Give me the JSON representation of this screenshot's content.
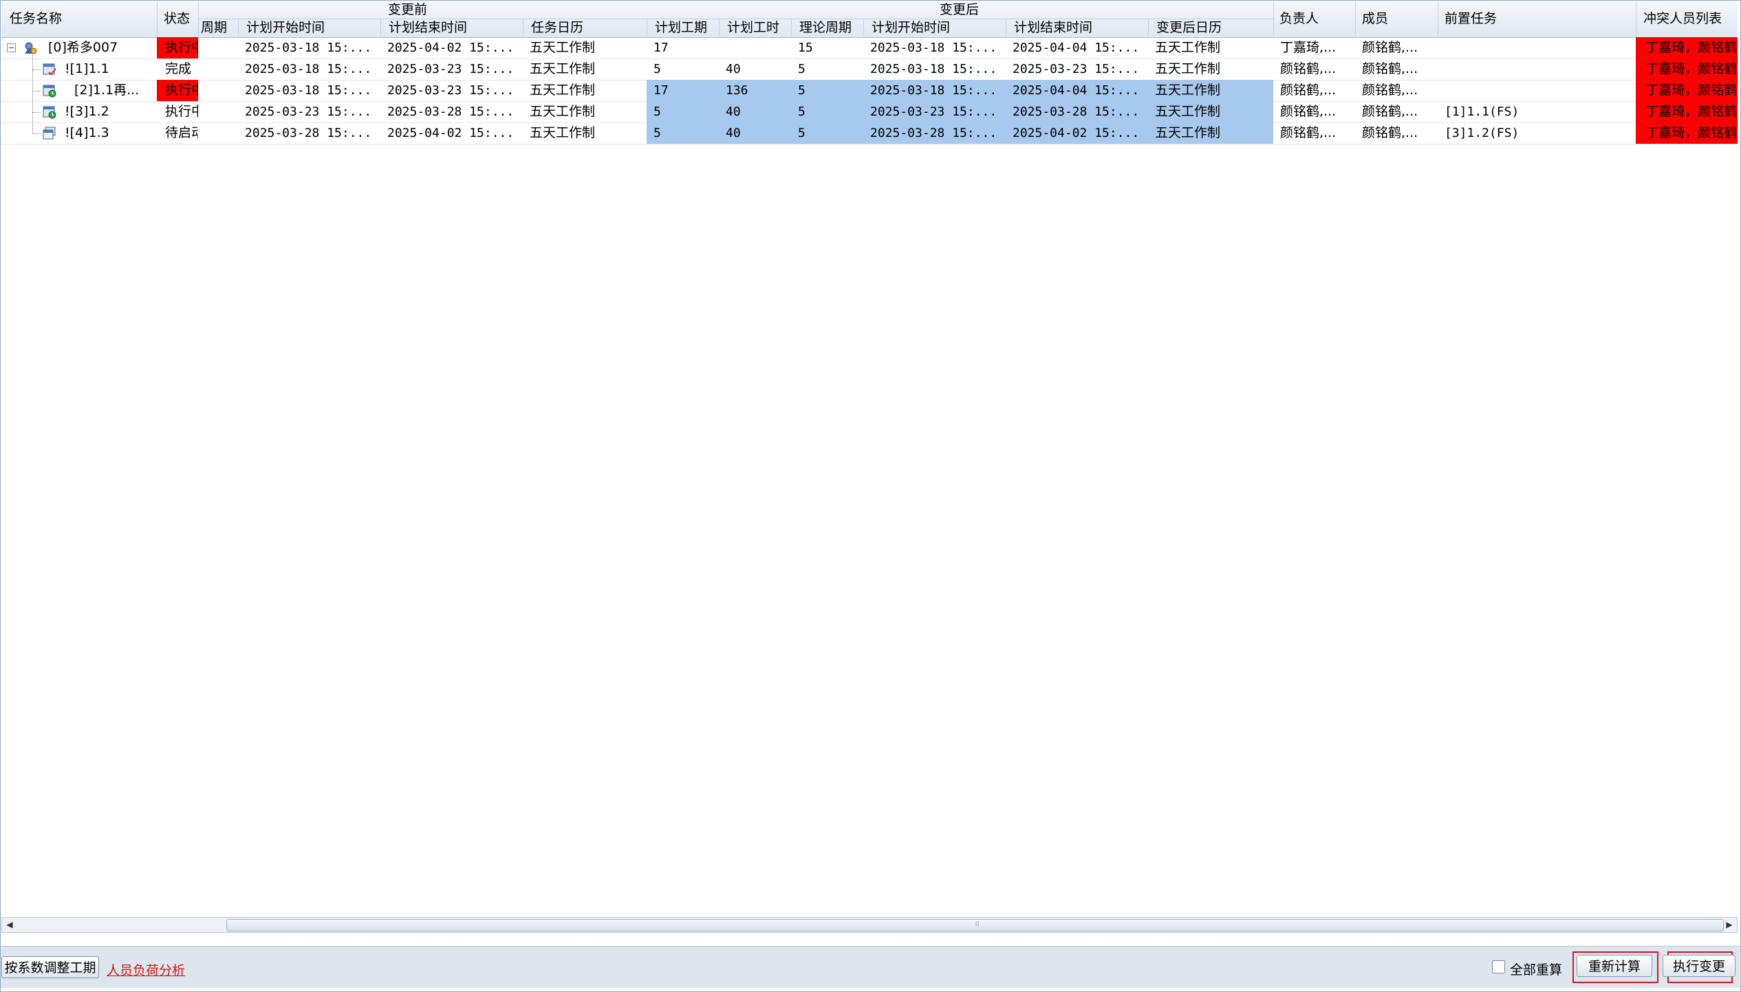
{
  "header": {
    "group_before": "变更前",
    "group_after": "变更后",
    "columns": {
      "task_name": "任务名称",
      "status": "状态",
      "cycle_before": "周期",
      "plan_start_before": "计划开始时间",
      "plan_end_before": "计划结束时间",
      "task_calendar": "任务日历",
      "plan_duration": "计划工期",
      "plan_hours": "计划工时",
      "theory_cycle": "理论周期",
      "plan_start_after": "计划开始时间",
      "plan_end_after": "计划结束时间",
      "calendar_after": "变更后日历",
      "owner": "负责人",
      "members": "成员",
      "predecessor": "前置任务",
      "conflict_list": "冲突人员列表"
    }
  },
  "rows": [
    {
      "name": "[0]希多007",
      "status": "执行中",
      "plan_start_before": "2025-03-18 15:...",
      "plan_end_before": "2025-04-02 15:...",
      "task_calendar": "五天工作制",
      "plan_duration": "17",
      "plan_hours": "",
      "theory_cycle": "15",
      "plan_start_after": "2025-03-18 15:...",
      "plan_end_after": "2025-04-04 15:...",
      "calendar_after": "五天工作制",
      "owner": "丁嘉琦,...",
      "members": "颜铭鹤,...",
      "predecessor": "",
      "conflict": "丁嘉琦，颜铭鹤"
    },
    {
      "name": "![1]1.1",
      "status": "完成",
      "plan_start_before": "2025-03-18 15:...",
      "plan_end_before": "2025-03-23 15:...",
      "task_calendar": "五天工作制",
      "plan_duration": "5",
      "plan_hours": "40",
      "theory_cycle": "5",
      "plan_start_after": "2025-03-18 15:...",
      "plan_end_after": "2025-03-23 15:...",
      "calendar_after": "五天工作制",
      "owner": "颜铭鹤,...",
      "members": "颜铭鹤,...",
      "predecessor": "",
      "conflict": "丁嘉琦，颜铭鹤"
    },
    {
      "name": "[2]1.1再...",
      "status": "执行中",
      "plan_start_before": "2025-03-18 15:...",
      "plan_end_before": "2025-03-23 15:...",
      "task_calendar": "五天工作制",
      "plan_duration": "17",
      "plan_hours": "136",
      "theory_cycle": "5",
      "plan_start_after": "2025-03-18 15:...",
      "plan_end_after": "2025-04-04 15:...",
      "calendar_after": "五天工作制",
      "owner": "颜铭鹤,...",
      "members": "颜铭鹤,...",
      "predecessor": "",
      "conflict": "丁嘉琦，颜铭鹤"
    },
    {
      "name": "![3]1.2",
      "status": "执行中",
      "plan_start_before": "2025-03-23 15:...",
      "plan_end_before": "2025-03-28 15:...",
      "task_calendar": "五天工作制",
      "plan_duration": "5",
      "plan_hours": "40",
      "theory_cycle": "5",
      "plan_start_after": "2025-03-23 15:...",
      "plan_end_after": "2025-03-28 15:...",
      "calendar_after": "五天工作制",
      "owner": "颜铭鹤,...",
      "members": "颜铭鹤,...",
      "predecessor": "[1]1.1(FS)",
      "conflict": "丁嘉琦，颜铭鹤"
    },
    {
      "name": "![4]1.3",
      "status": "待启动",
      "plan_start_before": "2025-03-28 15:...",
      "plan_end_before": "2025-04-02 15:...",
      "task_calendar": "五天工作制",
      "plan_duration": "5",
      "plan_hours": "40",
      "theory_cycle": "5",
      "plan_start_after": "2025-03-28 15:...",
      "plan_end_after": "2025-04-02 15:...",
      "calendar_after": "五天工作制",
      "owner": "颜铭鹤,...",
      "members": "颜铭鹤,...",
      "predecessor": "[3]1.2(FS)",
      "conflict": "丁嘉琦，颜铭鹤"
    }
  ],
  "scrollbar": {
    "grip": "⁞⁞"
  },
  "footer": {
    "adjust_button": "按系数调整工期",
    "load_analysis_link": "人员负荷分析",
    "recalc_all_label": "全部重算",
    "recalc_all_checked": false,
    "recalculate_button": "重新计算",
    "execute_button": "执行变更"
  },
  "colors": {
    "conflict": "#ff0000",
    "highlight": "#a8c9ee",
    "link": "#e01010",
    "focus_outline": "#d8141b"
  }
}
